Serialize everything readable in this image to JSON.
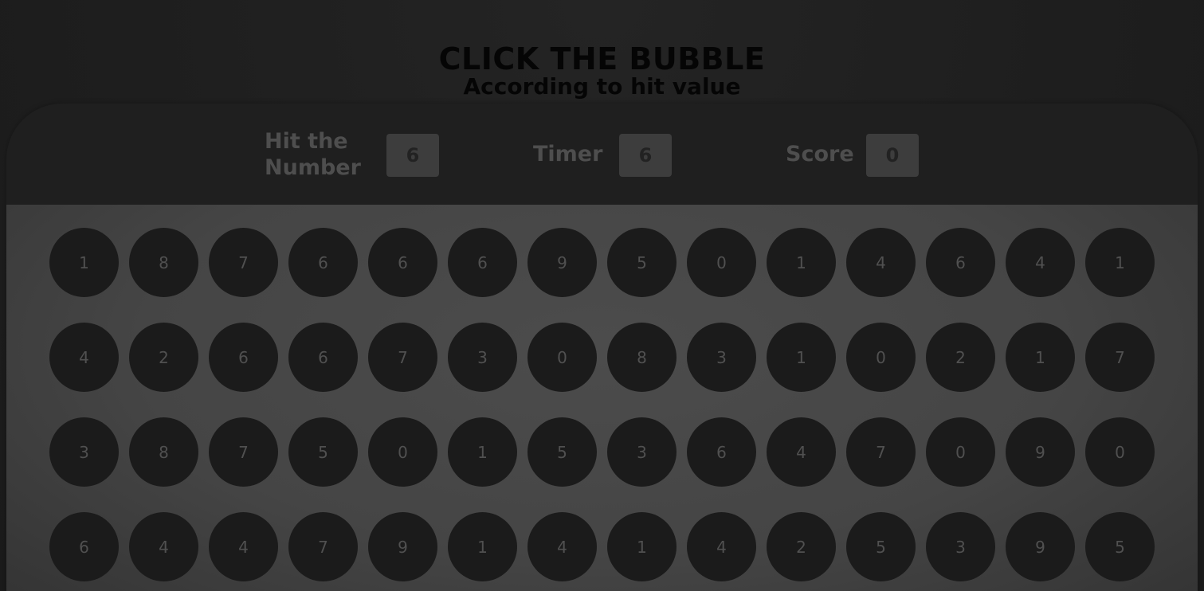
{
  "heading": {
    "title": "CLICK THE BUBBLE",
    "subtitle": "According to hit value"
  },
  "stats": {
    "hit": {
      "label_line1": "Hit the",
      "label_line2": "Number",
      "value": "6"
    },
    "timer": {
      "label": "Timer",
      "value": "6"
    },
    "score": {
      "label": "Score",
      "value": "0"
    }
  },
  "bubbles": [
    [
      "1",
      "8",
      "7",
      "6",
      "6",
      "6",
      "9",
      "5",
      "0",
      "1",
      "4",
      "6",
      "4",
      "1"
    ],
    [
      "4",
      "2",
      "6",
      "6",
      "7",
      "3",
      "0",
      "8",
      "3",
      "1",
      "0",
      "2",
      "1",
      "7"
    ],
    [
      "3",
      "8",
      "7",
      "5",
      "0",
      "1",
      "5",
      "3",
      "6",
      "4",
      "7",
      "0",
      "9",
      "0"
    ],
    [
      "6",
      "4",
      "4",
      "7",
      "9",
      "1",
      "4",
      "1",
      "4",
      "2",
      "5",
      "3",
      "9",
      "5"
    ]
  ],
  "colors": {
    "page_bg": "#1e1e1e",
    "board_bg": "#4c4c4c",
    "bubble_bg": "#1b1b1b",
    "stat_box_bg": "#3d3d3d",
    "title_color": "#050505"
  }
}
